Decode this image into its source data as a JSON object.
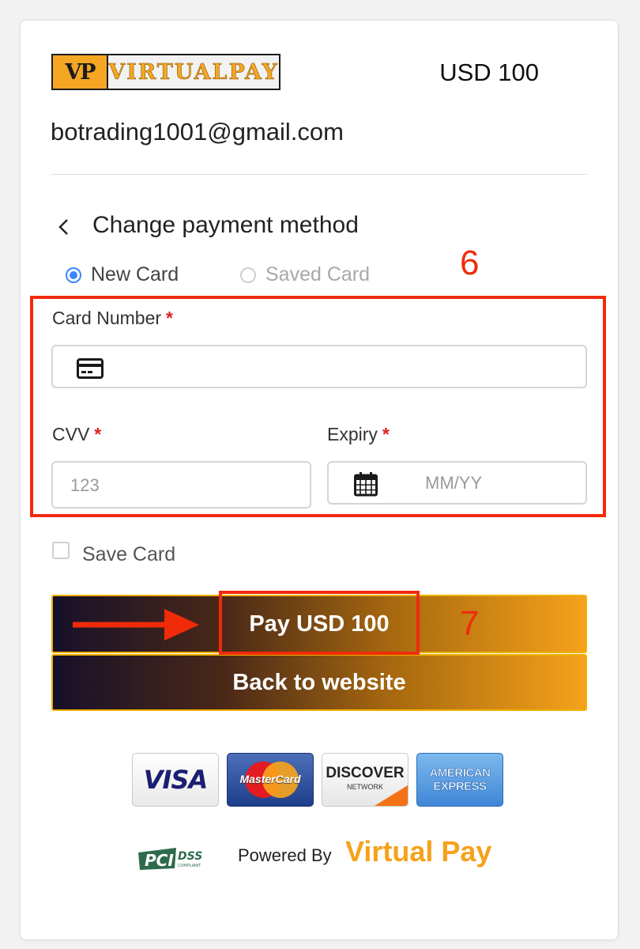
{
  "header": {
    "logo": {
      "mark": "VP",
      "text": "VIRTUALPAY"
    },
    "amount": "USD 100",
    "email": "botrading1001@gmail.com"
  },
  "payment": {
    "back_icon": "chevron-left-icon",
    "title": "Change payment method",
    "options": [
      {
        "label": "New Card",
        "selected": true
      },
      {
        "label": "Saved Card",
        "selected": false
      }
    ],
    "card_number": {
      "label": "Card Number",
      "required_mark": "*",
      "value": "",
      "placeholder": ""
    },
    "cvv": {
      "label": "CVV",
      "required_mark": "*",
      "value": "",
      "placeholder": "123"
    },
    "expiry": {
      "label": "Expiry",
      "required_mark": "*",
      "value": "",
      "placeholder": "MM/YY"
    },
    "save_card": {
      "label": "Save Card",
      "checked": false
    }
  },
  "buttons": {
    "pay": "Pay USD 100",
    "back_to_website": "Back to website"
  },
  "annotations": {
    "step6": "6",
    "step7": "7"
  },
  "footer": {
    "card_logos": {
      "visa": "VISA",
      "mastercard": "MasterCard",
      "discover": "DISCOVER",
      "discover_sub": "NETWORK",
      "amex_line1": "AMERICAN",
      "amex_line2": "EXPRESS"
    },
    "pci": {
      "main": "PCI",
      "sub": "DSS",
      "tag": "COMPLIANT"
    },
    "powered_by": "Powered By",
    "brand": "Virtual Pay"
  },
  "colors": {
    "accent": "#f5a21a",
    "annotation_red": "#f02b0a",
    "radio_blue": "#3a86ff",
    "required_red": "#e02020"
  }
}
